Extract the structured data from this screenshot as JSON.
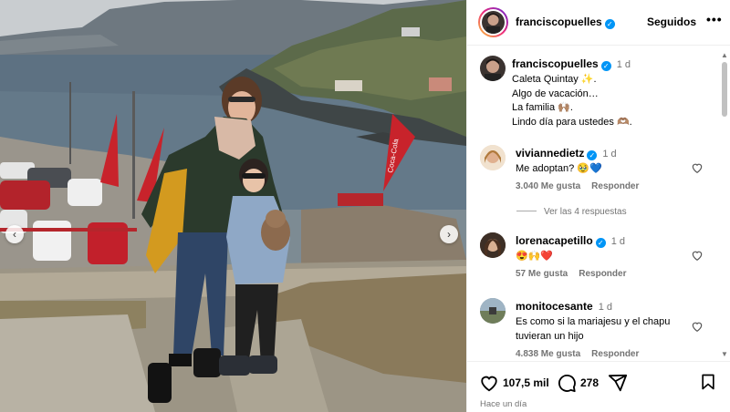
{
  "photo": {
    "description_icon": "photo-carousel",
    "boat_sign": "Coca-Cola"
  },
  "header": {
    "username": "franciscopuelles",
    "follow_label": "Seguidos",
    "more_label": "•••"
  },
  "caption": {
    "username": "franciscopuelles",
    "time": "1 d",
    "lines": [
      "Caleta Quintay ✨.",
      "Algo de vacación…",
      "La familia 🙌🏽.",
      "Lindo día para ustedes 🫶🏽."
    ]
  },
  "comments": [
    {
      "username": "viviannedietz",
      "verified": true,
      "time": "1 d",
      "text": "Me adoptan? 🥹💙",
      "likes": "3.040 Me gusta",
      "reply": "Responder",
      "replies_label": "Ver las 4 respuestas"
    },
    {
      "username": "lorenacapetillo",
      "verified": true,
      "time": "1 d",
      "text": "😍🙌❤️",
      "likes": "57 Me gusta",
      "reply": "Responder"
    },
    {
      "username": "monitocesante",
      "verified": false,
      "time": "1 d",
      "text": "Es como si la mariajesu y el chapu tuvieran un hijo",
      "likes": "4.838 Me gusta",
      "reply": "Responder"
    }
  ],
  "actions": {
    "like_count": "107,5 mil",
    "comment_count": "278",
    "timestamp": "Hace un día"
  },
  "colors": {
    "verified": "#0095f6",
    "muted": "#737373",
    "border": "#efefef"
  }
}
